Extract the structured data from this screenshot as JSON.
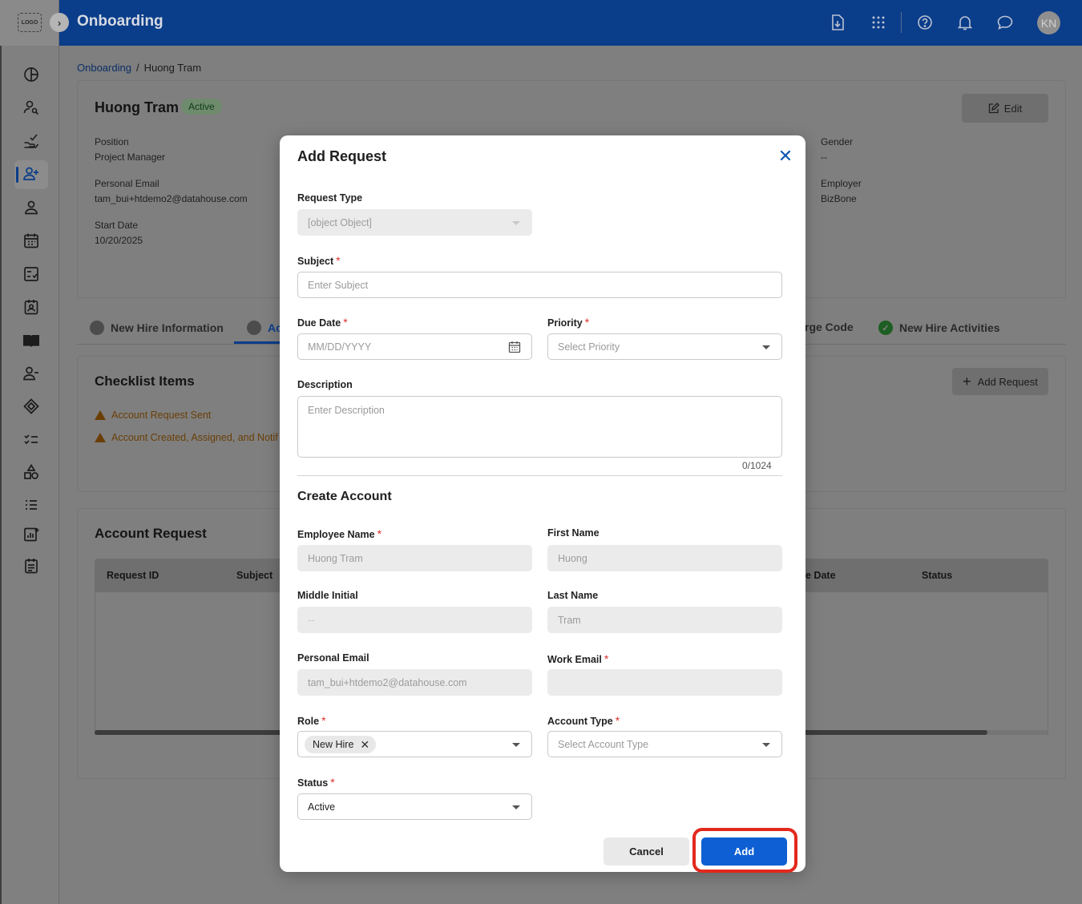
{
  "header": {
    "logo_text": "LOGO",
    "app_title": "Onboarding",
    "avatar_initials": "KN",
    "icons": [
      "download-icon",
      "apps-grid-icon",
      "help-icon",
      "bell-icon",
      "chat-icon"
    ]
  },
  "sidebar": {
    "items": [
      "dashboard-icon",
      "user-search-icon",
      "hand-check-icon",
      "user-plus-icon",
      "person-icon",
      "calendar-icon",
      "checklist-icon",
      "badge-icon",
      "book-icon",
      "user-minus-icon",
      "tag-icon",
      "task-list-icon",
      "shapes-icon",
      "list-icon",
      "report-icon",
      "schedule-icon"
    ],
    "active_index": 3
  },
  "breadcrumb": {
    "root": "Onboarding",
    "separator": "/",
    "current": "Huong Tram"
  },
  "employee": {
    "name": "Huong Tram",
    "status": "Active",
    "edit_label": "Edit",
    "position_label": "Position",
    "position": "Project Manager",
    "email_label": "Personal Email",
    "email": "tam_bui+htdemo2@datahouse.com",
    "start_label": "Start Date",
    "start_date": "10/20/2025",
    "gender_label": "Gender",
    "gender": "--",
    "employer_label": "Employer",
    "employer": "BizBone"
  },
  "tabs": {
    "new_hire_info": "New Hire Information",
    "account_partial": "Ac",
    "charge_code_partial": "rge Code",
    "activities": "New Hire Activities"
  },
  "checklist": {
    "title": "Checklist Items",
    "add_request": "Add Request",
    "items": [
      "Account Request Sent",
      "Account Created, Assigned, and Notif"
    ]
  },
  "account_request": {
    "title": "Account Request",
    "columns": [
      "Request ID",
      "Subject",
      "e Date",
      "Status"
    ]
  },
  "modal": {
    "title": "Add Request",
    "request_type_label": "Request Type",
    "request_type_value": "[object Object]",
    "subject_label": "Subject",
    "subject_placeholder": "Enter Subject",
    "due_date_label": "Due Date",
    "due_date_placeholder": "MM/DD/YYYY",
    "priority_label": "Priority",
    "priority_placeholder": "Select Priority",
    "description_label": "Description",
    "description_placeholder": "Enter Description",
    "description_counter": "0/1024",
    "create_account_title": "Create Account",
    "employee_name_label": "Employee Name",
    "employee_name_value": "Huong Tram",
    "first_name_label": "First Name",
    "first_name_value": "Huong",
    "middle_initial_label": "Middle Initial",
    "middle_initial_value": "--",
    "last_name_label": "Last Name",
    "last_name_value": "Tram",
    "personal_email_label": "Personal Email",
    "personal_email_value": "tam_bui+htdemo2@datahouse.com",
    "work_email_label": "Work Email",
    "work_email_value": "",
    "role_label": "Role",
    "role_chip": "New Hire",
    "account_type_label": "Account Type",
    "account_type_placeholder": "Select Account Type",
    "status_label": "Status",
    "status_value": "Active",
    "required_mark": "*",
    "cancel_label": "Cancel",
    "add_label": "Add"
  },
  "colors": {
    "header_bg": "#0a3d8a",
    "primary_button": "#0d5fd3",
    "highlight_ring": "#e3281d",
    "required": "#d9302b"
  }
}
